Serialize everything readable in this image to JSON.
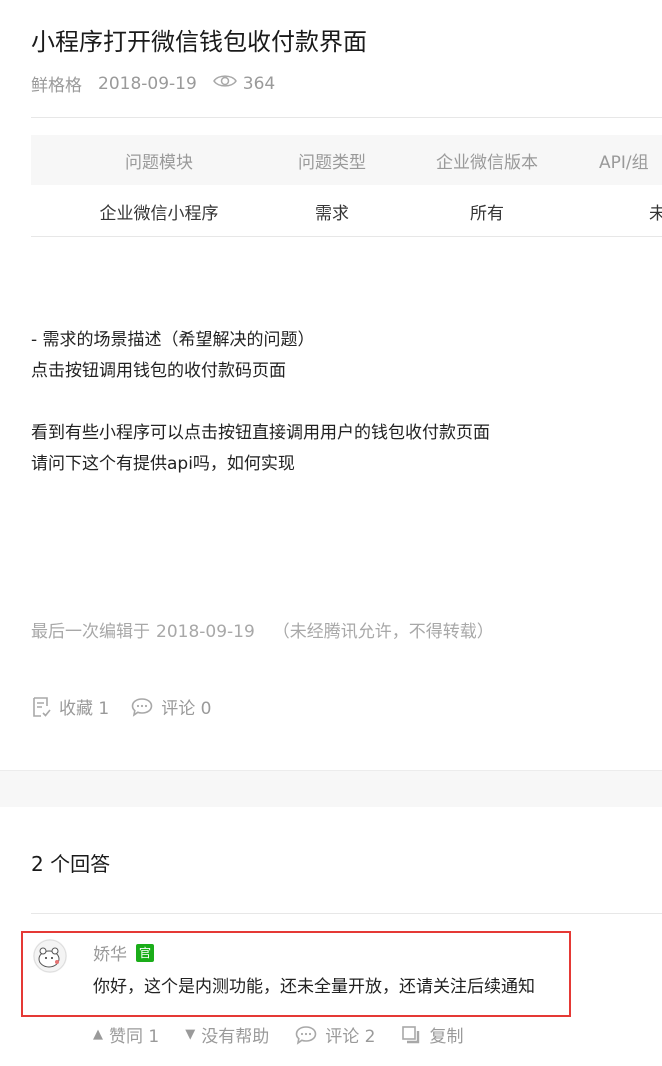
{
  "post": {
    "title": "小程序打开微信钱包收付款界面",
    "author": "鲜格格",
    "date": "2018-09-19",
    "views": "364"
  },
  "info_table": {
    "headers": [
      "问题模块",
      "问题类型",
      "企业微信版本",
      "API/组"
    ],
    "values": [
      "企业微信小程序",
      "需求",
      "所有",
      "未"
    ]
  },
  "content_lines": [
    "- 需求的场景描述（希望解决的问题）",
    "点击按钮调用钱包的收付款码页面",
    "",
    "看到有些小程序可以点击按钮直接调用用户的钱包收付款页面",
    "请问下这个有提供api吗，如何实现"
  ],
  "edited": {
    "label": "最后一次编辑于",
    "date": "2018-09-19",
    "note": "（未经腾讯允许，不得转载）"
  },
  "post_actions": {
    "favorite_label": "收藏 1",
    "comment_label": "评论 0"
  },
  "answers": {
    "count_label": "2 个回答",
    "items": [
      {
        "author": "娇华",
        "badge": "官",
        "text": "你好，这个是内测功能，还未全量开放，还请关注后续通知",
        "like_label": "赞同 1",
        "unhelpful_label": "没有帮助",
        "comment_label": "评论 2",
        "copy_label": "复制"
      }
    ]
  },
  "colors": {
    "highlight_border": "#e53935",
    "official_badge": "#1aad19"
  }
}
